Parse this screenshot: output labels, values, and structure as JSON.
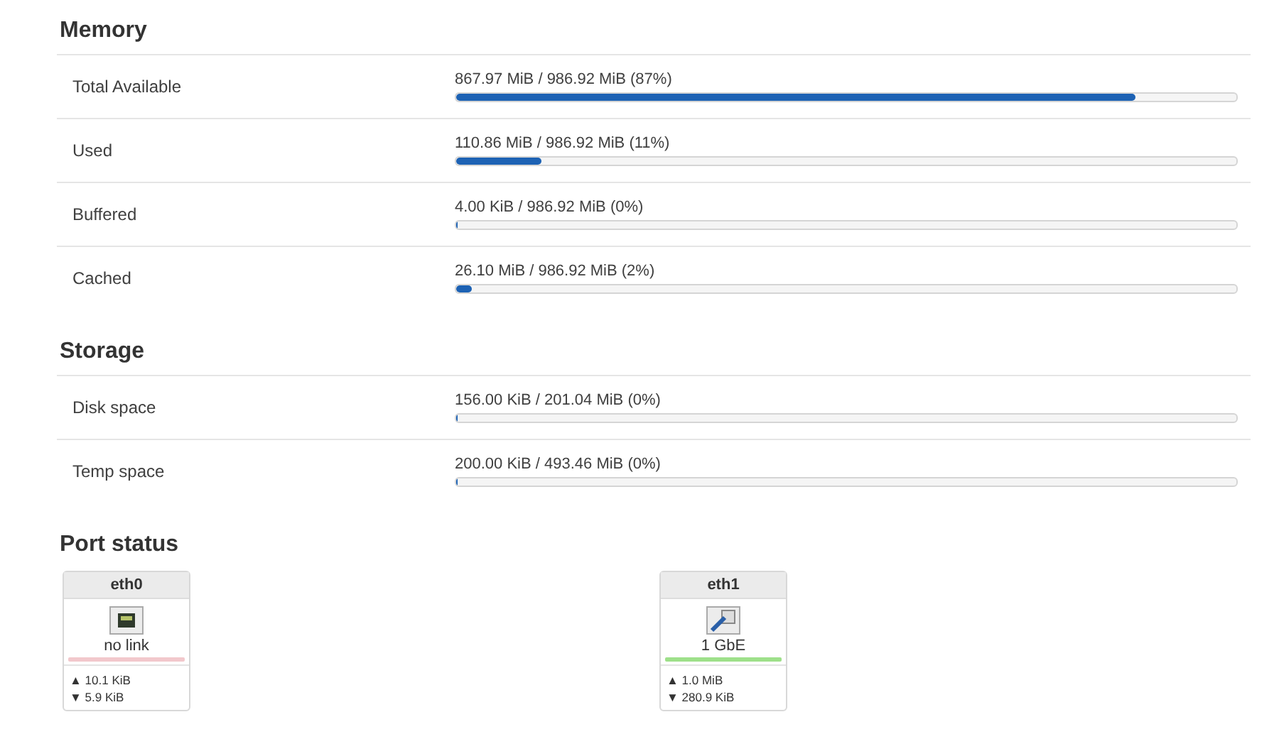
{
  "sections": [
    {
      "title": "Memory",
      "rows": [
        {
          "label": "Total Available",
          "reading": "867.97 MiB / 986.92 MiB (87%)",
          "level": 0.87
        },
        {
          "label": "Used",
          "reading": "110.86 MiB / 986.92 MiB (11%)",
          "level": 0.11
        },
        {
          "label": "Buffered",
          "reading": "4.00 KiB / 986.92 MiB (0%)",
          "level": 0
        },
        {
          "label": "Cached",
          "reading": "26.10 MiB / 986.92 MiB (2%)",
          "level": 0.02
        }
      ]
    },
    {
      "title": "Storage",
      "rows": [
        {
          "label": "Disk space",
          "reading": "156.00 KiB / 201.04 MiB (0%)",
          "level": 0
        },
        {
          "label": "Temp space",
          "reading": "200.00 KiB / 493.46 MiB (0%)",
          "level": 0
        }
      ]
    }
  ],
  "port_status": {
    "title": "Port status",
    "ports": [
      {
        "name": "eth0",
        "link": false,
        "speed": "no link",
        "tx_arrow": "▲",
        "tx": "10.1 KiB",
        "rx_arrow": "▼",
        "rx": "5.9 KiB"
      },
      {
        "name": "eth1",
        "link": true,
        "speed": "1 GbE",
        "tx_arrow": "▲",
        "tx": "1.0 MiB",
        "rx_arrow": "▼",
        "rx": "280.9 KiB"
      }
    ]
  }
}
